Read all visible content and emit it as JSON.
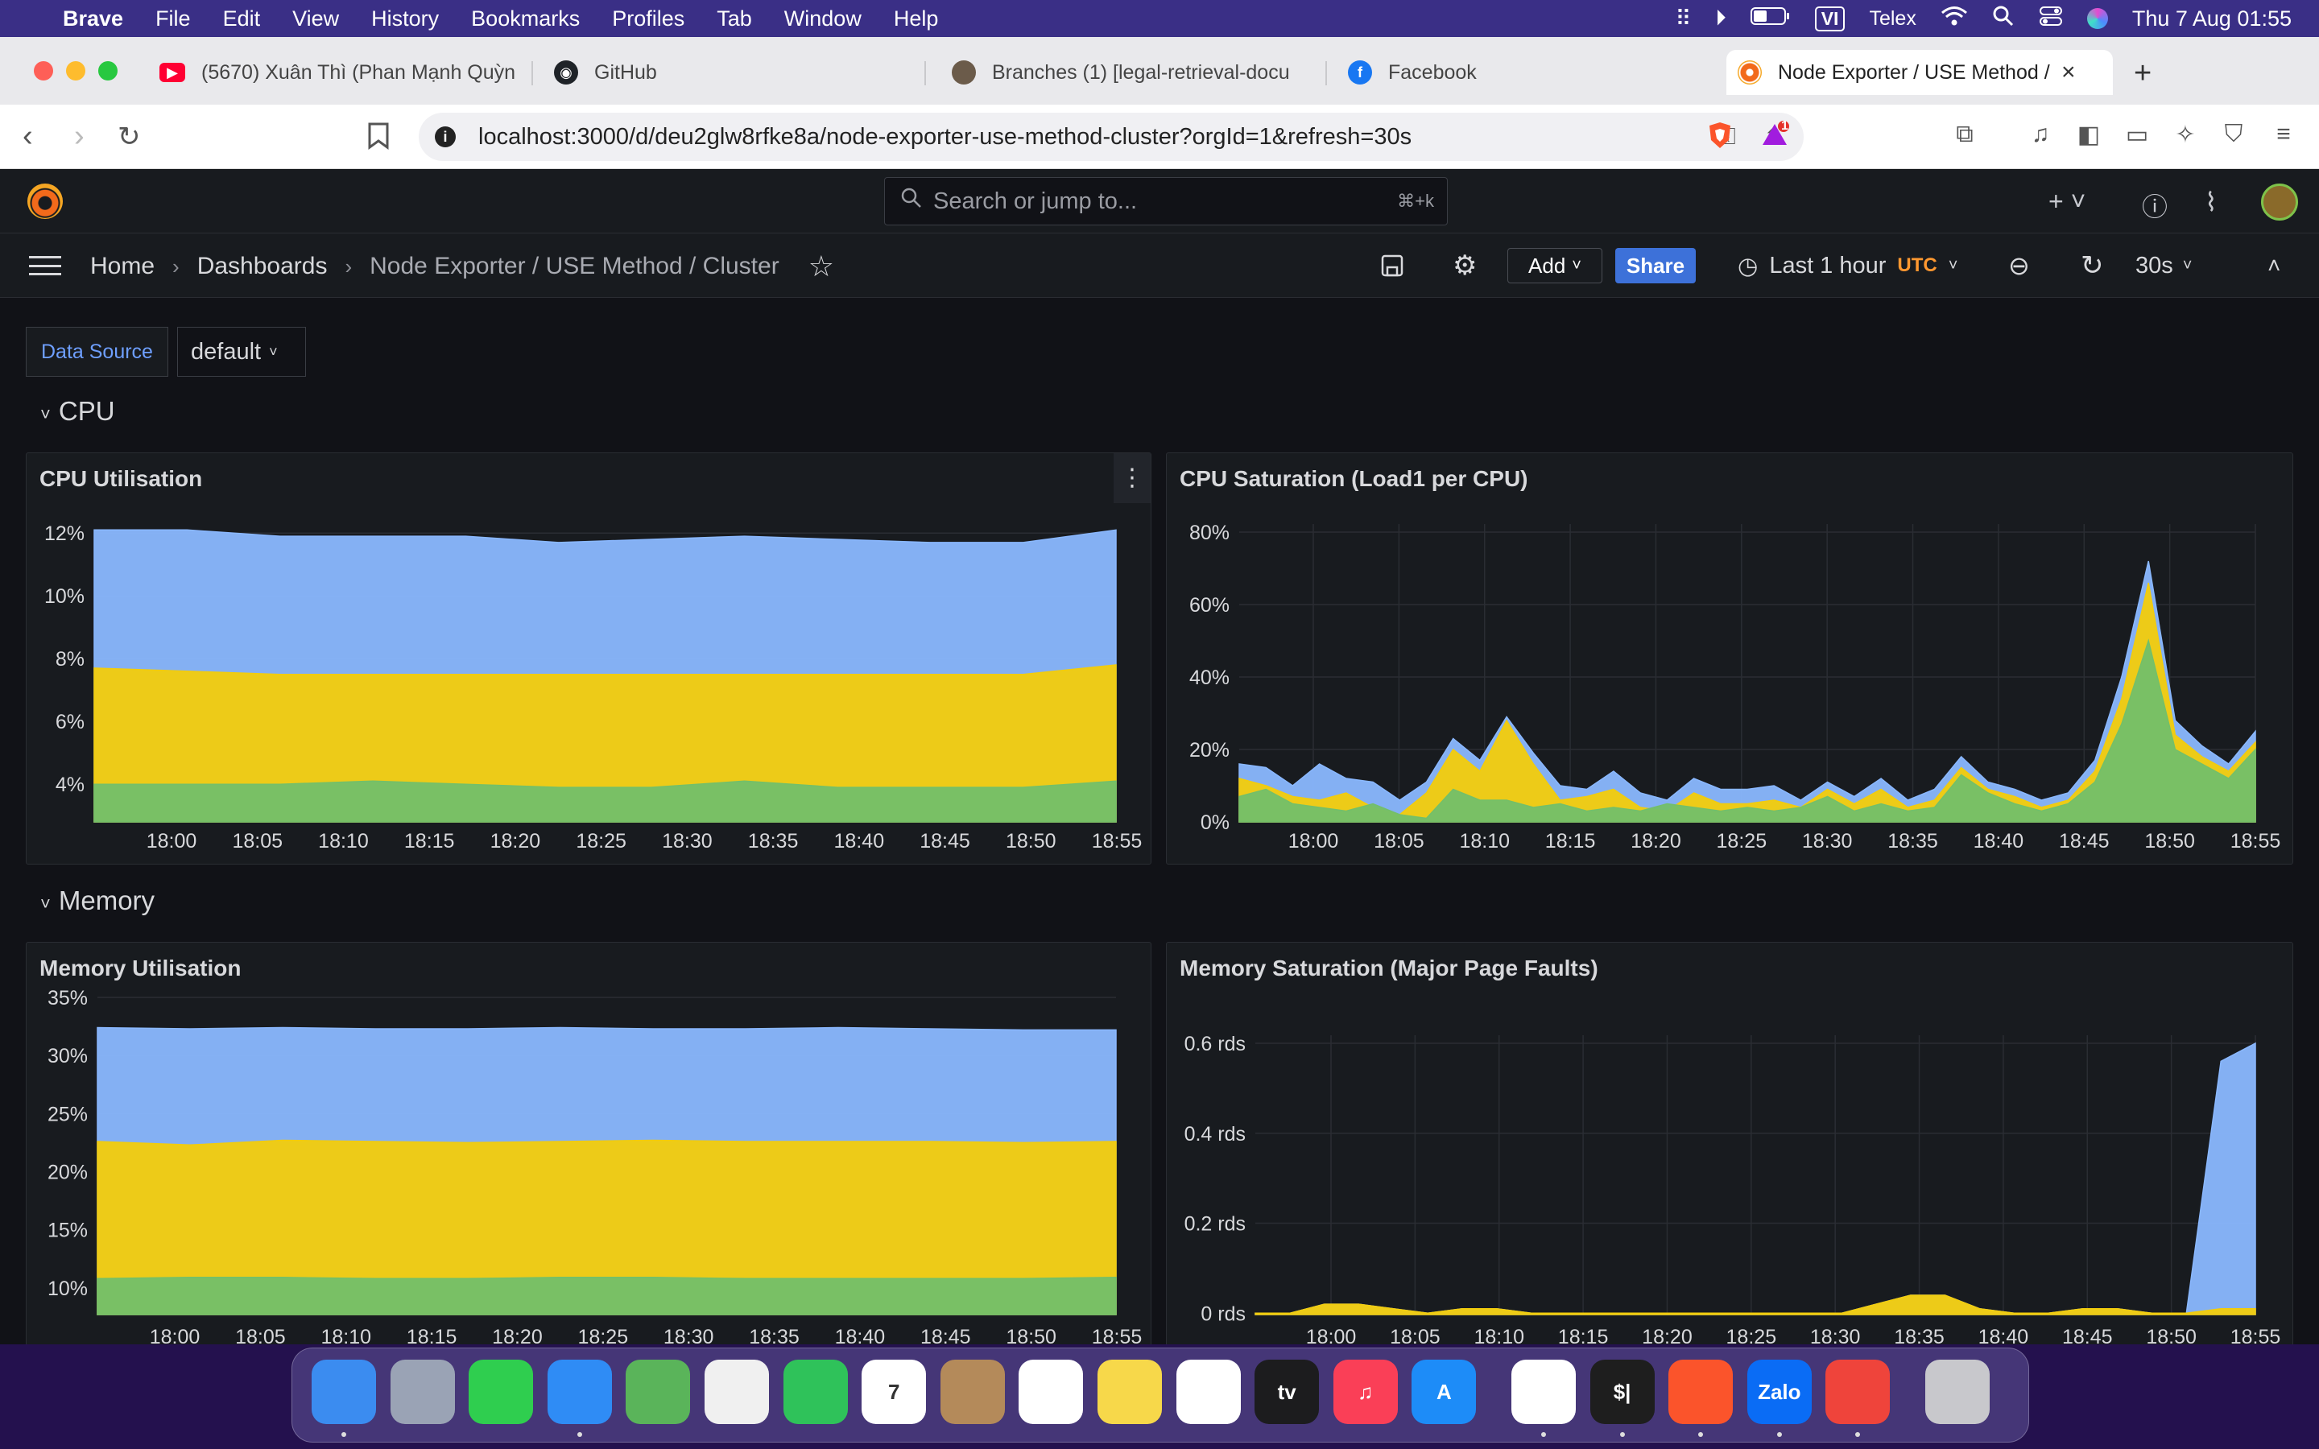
{
  "menubar": {
    "app": "Brave",
    "items": [
      "File",
      "Edit",
      "View",
      "History",
      "Bookmarks",
      "Profiles",
      "Tab",
      "Window",
      "Help"
    ],
    "input_badge": "VI",
    "input_method": "Telex",
    "datetime": "Thu 7 Aug  01:55"
  },
  "tabs": [
    {
      "title": "(5670) Xuân Thì (Phan Mạnh Quỳn",
      "icon": "youtube-icon",
      "color": "#ff0033"
    },
    {
      "title": "GitHub",
      "icon": "github-icon",
      "color": "#1f2328"
    },
    {
      "title": "Branches (1) [legal-retrieval-docu",
      "icon": "avatar-icon",
      "color": "#6b5b4a"
    },
    {
      "title": "Facebook",
      "icon": "facebook-icon",
      "color": "#1877f2"
    },
    {
      "title": "Node Exporter / USE Method /",
      "icon": "grafana-icon",
      "color": "#f26a1b",
      "active": true
    }
  ],
  "address": {
    "url": "localhost:3000/d/deu2glw8rfke8a/node-exporter-use-method-cluster?orgId=1&refresh=30s",
    "brave_badge": "1"
  },
  "grafana": {
    "search_placeholder": "Search or jump to...",
    "search_shortcut": "⌘+k",
    "breadcrumbs": [
      "Home",
      "Dashboards",
      "Node Exporter / USE Method / Cluster"
    ],
    "add_label": "Add",
    "share_label": "Share",
    "time_range": "Last 1 hour",
    "timezone": "UTC",
    "refresh": "30s",
    "variable_label": "Data Source",
    "variable_value": "default"
  },
  "rows": {
    "cpu": "CPU",
    "memory": "Memory"
  },
  "panels": {
    "cpu_util": {
      "title": "CPU Utilisation"
    },
    "cpu_sat": {
      "title": "CPU Saturation (Load1 per CPU)"
    },
    "mem_util": {
      "title": "Memory Utilisation"
    },
    "mem_sat": {
      "title": "Memory Saturation (Major Page Faults)"
    }
  },
  "colors": {
    "green": "#73bf69",
    "yellow": "#f2cc0c",
    "blue": "#8ab8ff"
  },
  "chart_data": [
    {
      "type": "area",
      "title": "CPU Utilisation",
      "stacked": true,
      "x": [
        "18:00",
        "18:05",
        "18:10",
        "18:15",
        "18:20",
        "18:25",
        "18:30",
        "18:35",
        "18:40",
        "18:45",
        "18:50",
        "18:55"
      ],
      "y_ticks": [
        "4%",
        "6%",
        "8%",
        "10%",
        "12%"
      ],
      "ylim": [
        2.8,
        12.8
      ],
      "series": [
        {
          "color": "#73bf69",
          "values": [
            4.0,
            4.0,
            4.0,
            4.1,
            4.0,
            3.9,
            3.9,
            4.1,
            3.9,
            3.9,
            3.9,
            4.1
          ]
        },
        {
          "color": "#f2cc0c",
          "values": [
            7.7,
            7.6,
            7.5,
            7.5,
            7.5,
            7.5,
            7.5,
            7.5,
            7.5,
            7.5,
            7.5,
            7.8
          ]
        },
        {
          "color": "#8ab8ff",
          "values": [
            12.1,
            12.1,
            11.9,
            11.9,
            11.9,
            11.7,
            11.8,
            11.9,
            11.8,
            11.7,
            11.7,
            12.1
          ]
        }
      ]
    },
    {
      "type": "area",
      "title": "CPU Saturation (Load1 per CPU)",
      "stacked": true,
      "x": [
        "18:00",
        "18:05",
        "18:10",
        "18:15",
        "18:20",
        "18:25",
        "18:30",
        "18:35",
        "18:40",
        "18:45",
        "18:50",
        "18:55"
      ],
      "y_ticks": [
        "0%",
        "20%",
        "40%",
        "60%",
        "80%"
      ],
      "ylim": [
        0,
        80
      ],
      "series": [
        {
          "color": "#73bf69",
          "values": [
            7,
            9,
            5,
            4,
            3,
            5,
            2,
            1,
            9,
            6,
            6,
            4,
            5,
            3,
            4,
            3,
            5,
            4,
            3,
            4,
            3,
            4,
            7,
            3,
            5,
            3,
            4,
            13,
            8,
            5,
            3,
            5,
            11,
            27,
            50,
            20,
            16,
            12,
            20
          ]
        },
        {
          "color": "#f2cc0c",
          "values": [
            12,
            10,
            7,
            6,
            8,
            4,
            2,
            8,
            20,
            14,
            28,
            16,
            6,
            7,
            9,
            4,
            3,
            8,
            5,
            5,
            6,
            4,
            9,
            5,
            9,
            4,
            6,
            15,
            9,
            7,
            4,
            6,
            14,
            34,
            66,
            24,
            18,
            14,
            22
          ]
        },
        {
          "color": "#8ab8ff",
          "values": [
            16,
            15,
            10,
            16,
            12,
            11,
            6,
            11,
            23,
            17,
            29,
            19,
            10,
            9,
            14,
            8,
            6,
            12,
            9,
            9,
            10,
            6,
            11,
            7,
            12,
            6,
            9,
            18,
            11,
            9,
            6,
            8,
            17,
            40,
            72,
            28,
            21,
            16,
            25
          ]
        }
      ]
    },
    {
      "type": "area",
      "title": "Memory Utilisation",
      "stacked": true,
      "x": [
        "18:00",
        "18:05",
        "18:10",
        "18:15",
        "18:20",
        "18:25",
        "18:30",
        "18:35",
        "18:40",
        "18:45",
        "18:50",
        "18:55"
      ],
      "y_ticks": [
        "10%",
        "15%",
        "20%",
        "25%",
        "30%",
        "35%"
      ],
      "ylim": [
        7.7,
        35
      ],
      "series": [
        {
          "color": "#73bf69",
          "values": [
            10.8,
            10.9,
            10.9,
            10.8,
            10.8,
            10.9,
            10.9,
            10.8,
            10.8,
            10.8,
            10.8,
            10.9
          ]
        },
        {
          "color": "#f2cc0c",
          "values": [
            22.6,
            22.3,
            22.7,
            22.6,
            22.5,
            22.6,
            22.7,
            22.6,
            22.6,
            22.6,
            22.5,
            22.6
          ]
        },
        {
          "color": "#8ab8ff",
          "values": [
            32.4,
            32.3,
            32.4,
            32.3,
            32.3,
            32.4,
            32.3,
            32.3,
            32.4,
            32.3,
            32.2,
            32.2
          ]
        }
      ]
    },
    {
      "type": "area",
      "title": "Memory Saturation (Major Page Faults)",
      "stacked": true,
      "x": [
        "18:00",
        "18:05",
        "18:10",
        "18:15",
        "18:20",
        "18:25",
        "18:30",
        "18:35",
        "18:40",
        "18:45",
        "18:50",
        "18:55"
      ],
      "y_ticks": [
        "0 rds",
        "0.2 rds",
        "0.4 rds",
        "0.6 rds"
      ],
      "ylim": [
        -0.003,
        0.6
      ],
      "series": [
        {
          "color": "#f2cc0c",
          "values": [
            0,
            0,
            0.02,
            0.02,
            0.01,
            0,
            0.01,
            0.01,
            0,
            0,
            0,
            0,
            0,
            0,
            0,
            0,
            0,
            0,
            0.02,
            0.04,
            0.04,
            0.01,
            0,
            0,
            0.01,
            0.01,
            0,
            0,
            0.01,
            0.01
          ]
        },
        {
          "color": "#8ab8ff",
          "values": [
            0,
            0,
            0.02,
            0.02,
            0.01,
            0,
            0.01,
            0.01,
            0,
            0,
            0,
            0,
            0,
            0,
            0,
            0,
            0,
            0,
            0.02,
            0.04,
            0.04,
            0.01,
            0,
            0,
            0.01,
            0.01,
            0,
            0,
            0.56,
            0.6
          ]
        }
      ]
    }
  ],
  "dock": [
    {
      "icon": "finder-icon",
      "label": "",
      "color": "#3b8cf0",
      "running": true
    },
    {
      "icon": "launchpad-icon",
      "label": "",
      "color": "#9aa3b5"
    },
    {
      "icon": "messages-icon",
      "label": "",
      "color": "#2fce4f"
    },
    {
      "icon": "mail-icon",
      "label": "",
      "color": "#2f8cf5",
      "running": true
    },
    {
      "icon": "maps-icon",
      "label": "",
      "color": "#5ab45a"
    },
    {
      "icon": "photos-icon",
      "label": "",
      "color": "#f0f0f0"
    },
    {
      "icon": "facetime-icon",
      "label": "",
      "color": "#2fc25a"
    },
    {
      "icon": "calendar-icon",
      "label": "7",
      "color": "#ffffff"
    },
    {
      "icon": "contacts-icon",
      "label": "",
      "color": "#b48a5a"
    },
    {
      "icon": "reminders-icon",
      "label": "",
      "color": "#ffffff"
    },
    {
      "icon": "notes-icon",
      "label": "",
      "color": "#f7d84a"
    },
    {
      "icon": "freeform-icon",
      "label": "",
      "color": "#ffffff"
    },
    {
      "icon": "tv-icon",
      "label": "tv",
      "color": "#1c1c1e"
    },
    {
      "icon": "music-icon",
      "label": "♫",
      "color": "#fa3f57"
    },
    {
      "icon": "app-store-icon",
      "label": "A",
      "color": "#1d8cf8"
    },
    {
      "icon": "vscode-icon",
      "label": "",
      "color": "#ffffff",
      "running": true
    },
    {
      "icon": "terminal-icon",
      "label": "$|",
      "color": "#1e1e1e",
      "running": true
    },
    {
      "icon": "brave-icon",
      "label": "",
      "color": "#fb542b",
      "running": true
    },
    {
      "icon": "zalo-icon",
      "label": "Zalo",
      "color": "#0a6cf5",
      "running": true
    },
    {
      "icon": "anydesk-icon",
      "label": "",
      "color": "#ef443b",
      "running": true
    },
    {
      "icon": "trash-icon",
      "label": "",
      "color": "#c8c8cc"
    }
  ]
}
